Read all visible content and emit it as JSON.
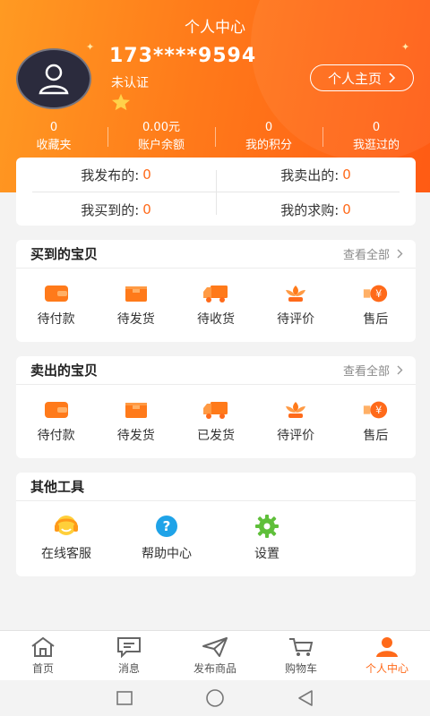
{
  "header": {
    "title": "个人中心",
    "phone": "173****9594",
    "verify_status": "未认证",
    "home_button": "个人主页",
    "stats": [
      {
        "value": "0",
        "label": "收藏夹"
      },
      {
        "value": "0.00元",
        "label": "账户余额"
      },
      {
        "value": "0",
        "label": "我的积分"
      },
      {
        "value": "0",
        "label": "我逛过的"
      }
    ]
  },
  "summary": {
    "published_label": "我发布的:",
    "published_value": "0",
    "sold_label": "我卖出的:",
    "sold_value": "0",
    "bought_label": "我买到的:",
    "bought_value": "0",
    "wanted_label": "我的求购:",
    "wanted_value": "0"
  },
  "bought": {
    "title": "买到的宝贝",
    "more": "查看全部",
    "items": [
      "待付款",
      "待发货",
      "待收货",
      "待评价",
      "售后"
    ]
  },
  "sold": {
    "title": "卖出的宝贝",
    "more": "查看全部",
    "items": [
      "待付款",
      "待发货",
      "已发货",
      "待评价",
      "售后"
    ]
  },
  "tools": {
    "title": "其他工具",
    "items": [
      "在线客服",
      "帮助中心",
      "设置"
    ]
  },
  "nav": {
    "items": [
      "首页",
      "消息",
      "发布商品",
      "购物车",
      "个人中心"
    ]
  },
  "colors": {
    "accent": "#ff6a1a",
    "header_start": "#ff9a22",
    "header_end": "#ff5b14"
  }
}
